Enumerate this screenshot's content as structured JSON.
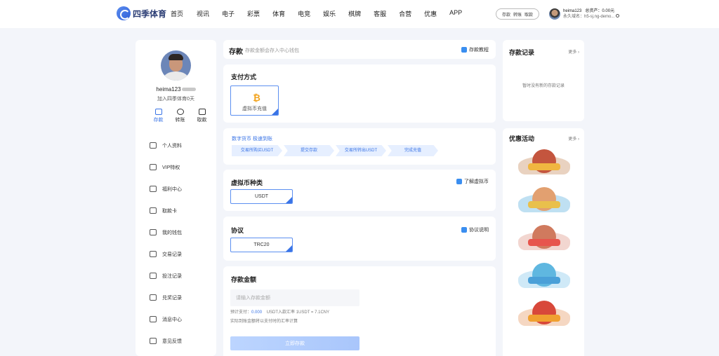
{
  "brand": {
    "name": "四季体育"
  },
  "nav": [
    "首页",
    "视讯",
    "电子",
    "彩票",
    "体育",
    "电竞",
    "娱乐",
    "棋牌",
    "客服",
    "合营",
    "优惠",
    "APP"
  ],
  "quick_actions": [
    "存款",
    "转账",
    "取款"
  ],
  "user_mini": {
    "name": "heima123",
    "assets_label": "总资产：",
    "assets_value": "0.00元",
    "domain": "永久域名：h5-sj.ng-demo..."
  },
  "profile": {
    "name": "heima123",
    "joined": "加入四季体育0天"
  },
  "profile_actions": [
    "存款",
    "转账",
    "取款"
  ],
  "menu": [
    "个人资料",
    "VIP特权",
    "福利中心",
    "取款卡",
    "我的钱包",
    "交易记录",
    "投注记录",
    "兑奖记录",
    "消息中心",
    "意见反馈"
  ],
  "deposit": {
    "title": "存款",
    "subtitle": "存款金额会存入中心钱包",
    "tutorial": "存款教程",
    "payment_title": "支付方式",
    "payment_option": "虚拟币充值",
    "steps_title": "数字货币 极速到账",
    "steps": [
      "交易所购买USDT",
      "提交存款",
      "交易所转出USDT",
      "完成充值"
    ],
    "coin_title": "虚拟币种类",
    "coin_help": "了解虚拟币",
    "coin_value": "USDT",
    "protocol_title": "协议",
    "protocol_help": "协议说明",
    "protocol_value": "TRC20",
    "amount_title": "存款金额",
    "amount_placeholder": "请输入存款金额",
    "est_label": "预计支付：",
    "est_value": "0.000",
    "rate": "USDT入款汇率 1USDT = 7.1CNY",
    "note": "实际到账金额将以支付时的汇率计算",
    "submit": "立即存款"
  },
  "records": {
    "title": "存款记录",
    "more": "更多 ›",
    "empty": "暂时没有新的存款记录"
  },
  "promos": {
    "title": "优惠活动",
    "more": "更多 ›"
  },
  "colors": {
    "accent": "#3a74e6",
    "coin": "#f2a21a"
  }
}
